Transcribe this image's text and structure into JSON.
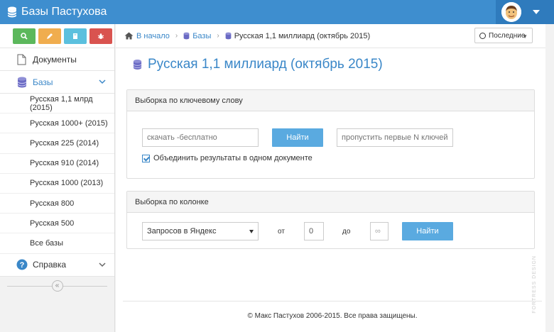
{
  "app": {
    "title": "Базы Пастухова"
  },
  "colors": {
    "topbar": "#3e8ecf",
    "accent": "#3a87c8",
    "button": "#5aaae0"
  },
  "quick_buttons": [
    {
      "icon": "search-icon",
      "color": "#5cb85c"
    },
    {
      "icon": "pencil-icon",
      "color": "#f0ad4e"
    },
    {
      "icon": "book-icon",
      "color": "#5bc0de"
    },
    {
      "icon": "bug-icon",
      "color": "#d9534f"
    }
  ],
  "sidebar": {
    "documents": "Документы",
    "bases": "Базы",
    "help": "Справка",
    "base_items": [
      "Русская 1,1 млрд (2015)",
      "Русская 1000+ (2015)",
      "Русская 225 (2014)",
      "Русская 910 (2014)",
      "Русская 1000 (2013)",
      "Русская 800",
      "Русская 500",
      "Все базы"
    ]
  },
  "breadcrumb": {
    "home": "В начало",
    "bases": "Базы",
    "current": "Русская 1,1 миллиард (октябрь 2015)"
  },
  "recent": {
    "label": "Последние"
  },
  "page": {
    "title": "Русская 1,1 миллиард (октябрь 2015)"
  },
  "keyword_panel": {
    "title": "Выборка по ключевому слову",
    "keyword_placeholder": "скачать -бесплатно",
    "find_label": "Найти",
    "skip_placeholder": "пропустить первые N ключей",
    "merge_label": "Объединить результаты в одном документе",
    "merge_checked": true
  },
  "column_panel": {
    "title": "Выборка по колонке",
    "column_value": "Запросов в Яндекс",
    "from_label": "от",
    "from_value": "0",
    "to_label": "до",
    "to_value": "∞",
    "find_label": "Найти"
  },
  "footer": {
    "text": "© Макс Пастухов 2006-2015. Все права защищены."
  },
  "watermark": {
    "text": "FORTRESS DESIGN"
  }
}
